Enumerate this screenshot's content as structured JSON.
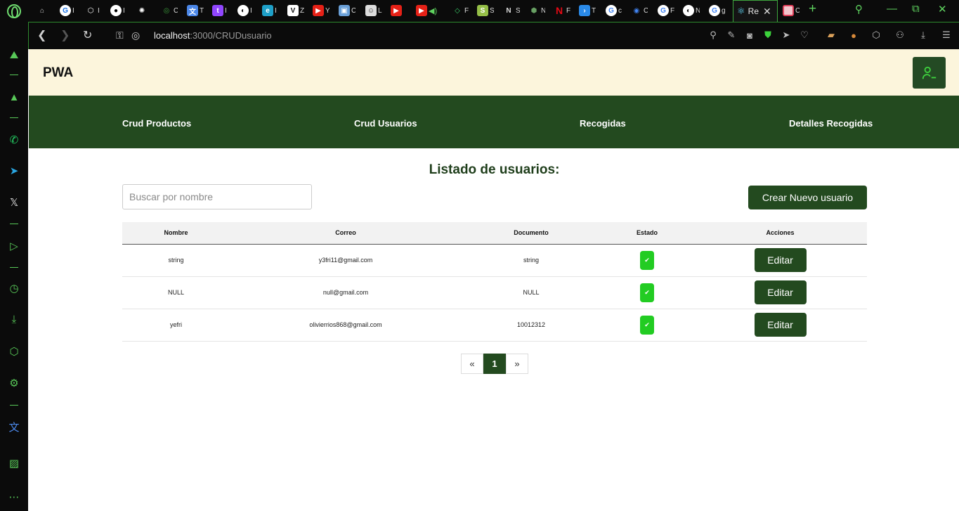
{
  "browser": {
    "active_tab_title": "Re",
    "url_host": "localhost",
    "url_path": ":3000/CRUDusuario",
    "tab_letters": [
      "I",
      "I",
      "I",
      "",
      "C",
      "T",
      "I",
      "I",
      "I",
      "Z",
      "Y",
      "C",
      "L",
      "",
      "F",
      "S",
      "S",
      "N",
      "F",
      "T",
      "c",
      "C",
      "F",
      "N",
      "g",
      "C"
    ]
  },
  "app": {
    "brand": "PWA",
    "nav": [
      "Crud Productos",
      "Crud Usuarios",
      "Recogidas",
      "Detalles Recogidas"
    ]
  },
  "content": {
    "title": "Listado de usuarios:",
    "search_placeholder": "Buscar por nombre",
    "create_label": "Crear Nuevo usuario",
    "columns": [
      "Nombre",
      "Correo",
      "Documento",
      "Estado",
      "Acciones"
    ],
    "rows": [
      {
        "nombre": "string",
        "correo": "y3fri11@gmail.com",
        "documento": "string",
        "estado": "active",
        "accion": "Editar"
      },
      {
        "nombre": "NULL",
        "correo": "null@gmail.com",
        "documento": "NULL",
        "estado": "active",
        "accion": "Editar"
      },
      {
        "nombre": "yefri",
        "correo": "olivierrios868@gmail.com",
        "documento": "10012312",
        "estado": "active",
        "accion": "Editar"
      }
    ],
    "pagination": {
      "prev": "«",
      "current": "1",
      "next": "»"
    }
  },
  "colors": {
    "primary": "#234a1f",
    "header_bg": "#fcf5dc",
    "active_check": "#22cc22",
    "browser_accent": "#58c858"
  }
}
